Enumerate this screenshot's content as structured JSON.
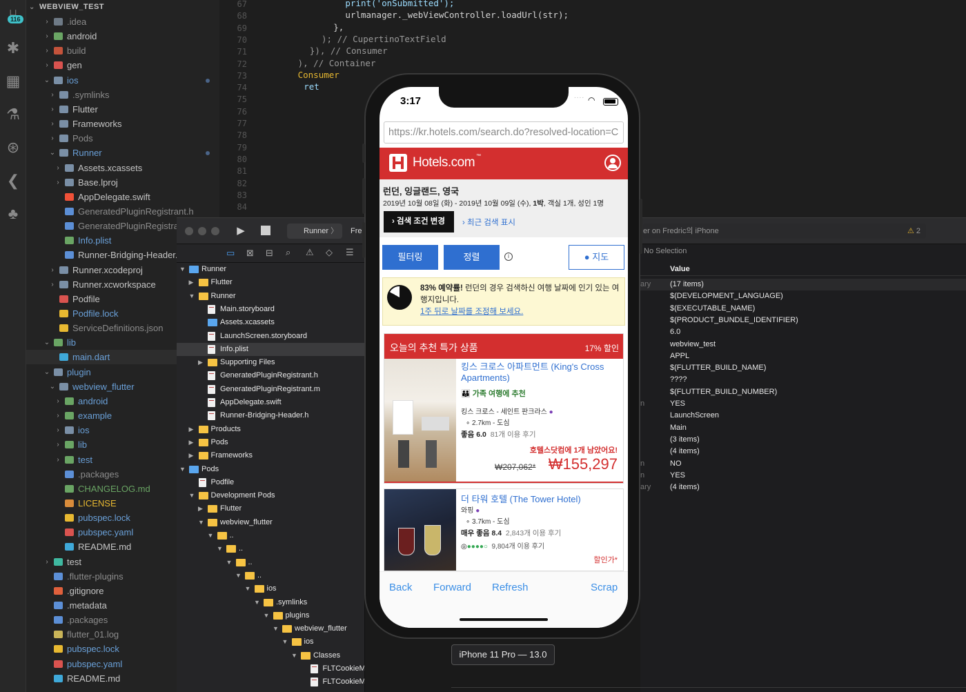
{
  "activity": {
    "badge": "116"
  },
  "explorer": {
    "title": "WEBVIEW_TEST",
    "items": [
      {
        "label": ".idea",
        "indent": 1,
        "chev": "closed",
        "color": "#8c8c8c",
        "icon": "#6e7a86"
      },
      {
        "label": "android",
        "indent": 1,
        "chev": "closed",
        "color": "#c5c5c5",
        "icon": "#6aa564"
      },
      {
        "label": "build",
        "indent": 1,
        "chev": "closed",
        "color": "#8c8c8c",
        "icon": "#c4533b"
      },
      {
        "label": "gen",
        "indent": 1,
        "chev": "closed",
        "color": "#c5c5c5",
        "icon": "#d9534f"
      },
      {
        "label": "ios",
        "indent": 1,
        "chev": "open",
        "color": "#6aa0d8",
        "icon": "#7a8fa6",
        "dot": true
      },
      {
        "label": ".symlinks",
        "indent": 2,
        "chev": "closed",
        "color": "#8c8c8c",
        "icon": "#7a8fa6"
      },
      {
        "label": "Flutter",
        "indent": 2,
        "chev": "closed",
        "color": "#c5c5c5",
        "icon": "#7a8fa6"
      },
      {
        "label": "Frameworks",
        "indent": 2,
        "chev": "closed",
        "color": "#c5c5c5",
        "icon": "#7a8fa6"
      },
      {
        "label": "Pods",
        "indent": 2,
        "chev": "closed",
        "color": "#8c8c8c",
        "icon": "#7a8fa6"
      },
      {
        "label": "Runner",
        "indent": 2,
        "chev": "open",
        "color": "#6aa0d8",
        "icon": "#7a8fa6",
        "dot": true
      },
      {
        "label": "Assets.xcassets",
        "indent": 3,
        "chev": "closed",
        "color": "#c5c5c5",
        "icon": "#7a8fa6"
      },
      {
        "label": "Base.lproj",
        "indent": 3,
        "chev": "closed",
        "color": "#c5c5c5",
        "icon": "#7a8fa6"
      },
      {
        "label": "AppDelegate.swift",
        "indent": 3,
        "chev": "none",
        "color": "#c5c5c5",
        "icon": "#f05138"
      },
      {
        "label": "GeneratedPluginRegistrant.h",
        "indent": 3,
        "chev": "none",
        "color": "#8c8c8c",
        "icon": "#5c8fd6"
      },
      {
        "label": "GeneratedPluginRegistrant.m",
        "indent": 3,
        "chev": "none",
        "color": "#8c8c8c",
        "icon": "#5c8fd6"
      },
      {
        "label": "Info.plist",
        "indent": 3,
        "chev": "none",
        "color": "#6aa0d8",
        "icon": "#6aa564"
      },
      {
        "label": "Runner-Bridging-Header.h",
        "indent": 3,
        "chev": "none",
        "color": "#c5c5c5",
        "icon": "#5c8fd6"
      },
      {
        "label": "Runner.xcodeproj",
        "indent": 2,
        "chev": "closed",
        "color": "#c5c5c5",
        "icon": "#7a8fa6"
      },
      {
        "label": "Runner.xcworkspace",
        "indent": 2,
        "chev": "closed",
        "color": "#c5c5c5",
        "icon": "#7a8fa6"
      },
      {
        "label": "Podfile",
        "indent": 2,
        "chev": "none",
        "color": "#c5c5c5",
        "icon": "#d9534f"
      },
      {
        "label": "Podfile.lock",
        "indent": 2,
        "chev": "none",
        "color": "#6aa0d8",
        "icon": "#e8b931"
      },
      {
        "label": "ServiceDefinitions.json",
        "indent": 2,
        "chev": "none",
        "color": "#8c8c8c",
        "icon": "#e8b931"
      },
      {
        "label": "lib",
        "indent": 1,
        "chev": "open",
        "color": "#6aa0d8",
        "icon": "#6aa564"
      },
      {
        "label": "main.dart",
        "indent": 2,
        "chev": "none",
        "color": "#6aa0d8",
        "icon": "#3fa9d9",
        "sel": true
      },
      {
        "label": "plugin",
        "indent": 1,
        "chev": "open",
        "color": "#6aa0d8",
        "icon": "#7a8fa6"
      },
      {
        "label": "webview_flutter",
        "indent": 2,
        "chev": "open",
        "color": "#6aa0d8",
        "icon": "#7a8fa6"
      },
      {
        "label": "android",
        "indent": 3,
        "chev": "closed",
        "color": "#6aa0d8",
        "icon": "#6aa564"
      },
      {
        "label": "example",
        "indent": 3,
        "chev": "closed",
        "color": "#6aa0d8",
        "icon": "#6aa564"
      },
      {
        "label": "ios",
        "indent": 3,
        "chev": "closed",
        "color": "#6aa0d8",
        "icon": "#7a8fa6"
      },
      {
        "label": "lib",
        "indent": 3,
        "chev": "closed",
        "color": "#6aa0d8",
        "icon": "#6aa564"
      },
      {
        "label": "test",
        "indent": 3,
        "chev": "closed",
        "color": "#6aa0d8",
        "icon": "#6aa564"
      },
      {
        "label": ".packages",
        "indent": 3,
        "chev": "none",
        "color": "#8c8c8c",
        "icon": "#5c8fd6"
      },
      {
        "label": "CHANGELOG.md",
        "indent": 3,
        "chev": "none",
        "color": "#6aa564",
        "icon": "#6aa564"
      },
      {
        "label": "LICENSE",
        "indent": 3,
        "chev": "none",
        "color": "#e8b931",
        "icon": "#d98c3b"
      },
      {
        "label": "pubspec.lock",
        "indent": 3,
        "chev": "none",
        "color": "#6aa0d8",
        "icon": "#e8b931"
      },
      {
        "label": "pubspec.yaml",
        "indent": 3,
        "chev": "none",
        "color": "#6aa0d8",
        "icon": "#d9534f"
      },
      {
        "label": "README.md",
        "indent": 3,
        "chev": "none",
        "color": "#c5c5c5",
        "icon": "#3fa9d9"
      },
      {
        "label": "test",
        "indent": 1,
        "chev": "closed",
        "color": "#c5c5c5",
        "icon": "#3fb8a0"
      },
      {
        "label": ".flutter-plugins",
        "indent": 1,
        "chev": "none",
        "color": "#8c8c8c",
        "icon": "#5c8fd6"
      },
      {
        "label": ".gitignore",
        "indent": 1,
        "chev": "none",
        "color": "#c5c5c5",
        "icon": "#e0603c"
      },
      {
        "label": ".metadata",
        "indent": 1,
        "chev": "none",
        "color": "#c5c5c5",
        "icon": "#5c8fd6"
      },
      {
        "label": ".packages",
        "indent": 1,
        "chev": "none",
        "color": "#8c8c8c",
        "icon": "#5c8fd6"
      },
      {
        "label": "flutter_01.log",
        "indent": 1,
        "chev": "none",
        "color": "#8c8c8c",
        "icon": "#c9b458"
      },
      {
        "label": "pubspec.lock",
        "indent": 1,
        "chev": "none",
        "color": "#6aa0d8",
        "icon": "#e8b931"
      },
      {
        "label": "pubspec.yaml",
        "indent": 1,
        "chev": "none",
        "color": "#6aa0d8",
        "icon": "#d9534f"
      },
      {
        "label": "README.md",
        "indent": 1,
        "chev": "none",
        "color": "#c5c5c5",
        "icon": "#3fa9d9"
      }
    ]
  },
  "editor": {
    "line_numbers": [
      "67",
      "68",
      "69",
      "70",
      "71",
      "72",
      "73",
      "74",
      "75",
      "76",
      "77",
      "78",
      "79",
      "80",
      "81",
      "82",
      "83",
      "84"
    ],
    "lines": [
      {
        "indent": 14,
        "text": "print('onSubmitted');",
        "color": "#9cdcfe"
      },
      {
        "indent": 14,
        "text": "urlmanager._webViewController.loadUrl(str);",
        "color": "#d4d4d4"
      },
      {
        "indent": 12,
        "text": "},",
        "color": "#d4d4d4"
      },
      {
        "indent": 10,
        "text": "); // CupertinoTextField",
        "color": "#9a9a9a"
      },
      {
        "indent": 8,
        "text": "}), // Consumer",
        "color": "#9a9a9a"
      },
      {
        "indent": 6,
        "text": "), // Container",
        "color": "#9a9a9a"
      },
      {
        "indent": 6,
        "text": "Consumer",
        "color": "#e8b931"
      },
      {
        "indent": 7,
        "text": "ret",
        "color": "#9cdcfe"
      }
    ]
  },
  "xcode": {
    "scheme": "Runner",
    "scheme_next": "Fre",
    "device_title": "er on Fredric의 iPhone",
    "warning_count": "2",
    "no_selection": "No Selection",
    "value_header": "Value",
    "navigator": [
      {
        "label": "Runner",
        "depth": 0,
        "tri": "open",
        "icon": "blue"
      },
      {
        "label": "Flutter",
        "depth": 1,
        "tri": "closed",
        "icon": "folder"
      },
      {
        "label": "Runner",
        "depth": 1,
        "tri": "open",
        "icon": "folder"
      },
      {
        "label": "Main.storyboard",
        "depth": 2,
        "tri": "none",
        "icon": "doc"
      },
      {
        "label": "Assets.xcassets",
        "depth": 2,
        "tri": "none",
        "icon": "blue"
      },
      {
        "label": "LaunchScreen.storyboard",
        "depth": 2,
        "tri": "none",
        "icon": "doc"
      },
      {
        "label": "Info.plist",
        "depth": 2,
        "tri": "none",
        "icon": "doc",
        "sel": true
      },
      {
        "label": "Supporting Files",
        "depth": 2,
        "tri": "closed",
        "icon": "folder"
      },
      {
        "label": "GeneratedPluginRegistrant.h",
        "depth": 2,
        "tri": "none",
        "icon": "doc"
      },
      {
        "label": "GeneratedPluginRegistrant.m",
        "depth": 2,
        "tri": "none",
        "icon": "doc"
      },
      {
        "label": "AppDelegate.swift",
        "depth": 2,
        "tri": "none",
        "icon": "doc"
      },
      {
        "label": "Runner-Bridging-Header.h",
        "depth": 2,
        "tri": "none",
        "icon": "doc"
      },
      {
        "label": "Products",
        "depth": 1,
        "tri": "closed",
        "icon": "folder"
      },
      {
        "label": "Pods",
        "depth": 1,
        "tri": "closed",
        "icon": "folder"
      },
      {
        "label": "Frameworks",
        "depth": 1,
        "tri": "closed",
        "icon": "folder"
      },
      {
        "label": "Pods",
        "depth": 0,
        "tri": "open",
        "icon": "blue"
      },
      {
        "label": "Podfile",
        "depth": 1,
        "tri": "none",
        "icon": "doc"
      },
      {
        "label": "Development Pods",
        "depth": 1,
        "tri": "open",
        "icon": "folder"
      },
      {
        "label": "Flutter",
        "depth": 2,
        "tri": "closed",
        "icon": "folder"
      },
      {
        "label": "webview_flutter",
        "depth": 2,
        "tri": "open",
        "icon": "folder"
      },
      {
        "label": "..",
        "depth": 3,
        "tri": "open",
        "icon": "folder"
      },
      {
        "label": "..",
        "depth": 4,
        "tri": "open",
        "icon": "folder"
      },
      {
        "label": "..",
        "depth": 5,
        "tri": "open",
        "icon": "folder"
      },
      {
        "label": "..",
        "depth": 6,
        "tri": "open",
        "icon": "folder"
      },
      {
        "label": "ios",
        "depth": 7,
        "tri": "open",
        "icon": "folder"
      },
      {
        "label": ".symlinks",
        "depth": 8,
        "tri": "open",
        "icon": "folder"
      },
      {
        "label": "plugins",
        "depth": 9,
        "tri": "open",
        "icon": "folder"
      },
      {
        "label": "webview_flutter",
        "depth": 10,
        "tri": "open",
        "icon": "folder"
      },
      {
        "label": "ios",
        "depth": 11,
        "tri": "open",
        "icon": "folder"
      },
      {
        "label": "Classes",
        "depth": 12,
        "tri": "open",
        "icon": "folder"
      },
      {
        "label": "FLTCookieManager.h",
        "depth": 13,
        "tri": "none",
        "icon": "doc"
      },
      {
        "label": "FLTCookieManager.m",
        "depth": 13,
        "tri": "none",
        "icon": "doc"
      }
    ],
    "plist": [
      {
        "key": "ary",
        "value": "(17 items)"
      },
      {
        "key": "",
        "value": "$(DEVELOPMENT_LANGUAGE)"
      },
      {
        "key": "",
        "value": "$(EXECUTABLE_NAME)"
      },
      {
        "key": "",
        "value": "$(PRODUCT_BUNDLE_IDENTIFIER)"
      },
      {
        "key": "",
        "value": "6.0"
      },
      {
        "key": "",
        "value": "webview_test"
      },
      {
        "key": "",
        "value": "APPL"
      },
      {
        "key": "",
        "value": "$(FLUTTER_BUILD_NAME)"
      },
      {
        "key": "",
        "value": "????"
      },
      {
        "key": "",
        "value": "$(FLUTTER_BUILD_NUMBER)"
      },
      {
        "key": "n",
        "value": "YES"
      },
      {
        "key": "",
        "value": "LaunchScreen"
      },
      {
        "key": "",
        "value": "Main"
      },
      {
        "key": "",
        "value": "(3 items)"
      },
      {
        "key": "",
        "value": "(4 items)"
      },
      {
        "key": "n",
        "value": "NO"
      },
      {
        "key": "n",
        "value": "YES"
      },
      {
        "key": "ary",
        "value": "(4 items)"
      }
    ],
    "simulator_label": "iPhone 11 Pro — 13.0"
  },
  "phone": {
    "time": "3:17",
    "url": "https://kr.hotels.com/search.do?resolved-location=C",
    "brand": "Hotels.com",
    "brand_tm": "™",
    "location": "런던, 잉글랜드, 영국",
    "dates_prefix": "2019년 10월 08일 (화) - 2019년 10월 09일 (수), ",
    "nights": "1박",
    "dates_suffix": ", 객실 1개, 성인 1명",
    "change_btn": "검색 조건 변경",
    "recent_link": "최근 검색 표시",
    "filter_btn": "필터링",
    "sort_btn": "정렬",
    "map_btn": "지도",
    "notice_bold": "83% 예약률!",
    "notice_text": " 런던의 경우 검색하신 여행 날짜에 인기 있는 여행지입니다.",
    "notice_link": "1주 뒤로 날짜를 조정해 보세요.",
    "deal_title": "오늘의 추천 특가 상품",
    "deal_discount": "17% 할인",
    "hotel1": {
      "name": "킹스 크로스 아파트먼트 (King's Cross Apartments)",
      "family": "가족 여행에 추천",
      "area": "킹스 크로스 - 세인트 판크라스",
      "distance": "2.7km - 도심",
      "rating_label": "좋음 6.0",
      "reviews": "81개 이용 후기",
      "left": "호텔스닷컴에 1개 남았어요!",
      "old_price": "₩207,062*",
      "price": "₩155,297"
    },
    "hotel2": {
      "name": "더 타워 호텔 (The Tower Hotel)",
      "area": "와핑",
      "distance": "3.7km - 도심",
      "rating_label": "매우 좋음 8.4",
      "reviews": "2,843개 이용 후기",
      "ta_reviews": "9,804개 이용 후기",
      "sale": "할인가*"
    },
    "nav": {
      "back": "Back",
      "forward": "Forward",
      "refresh": "Refresh",
      "scrap": "Scrap"
    },
    "colors": {
      "hotels_red": "#d32f2f",
      "link_blue": "#3a8ee6",
      "btn_blue": "#2f6fd0"
    }
  }
}
